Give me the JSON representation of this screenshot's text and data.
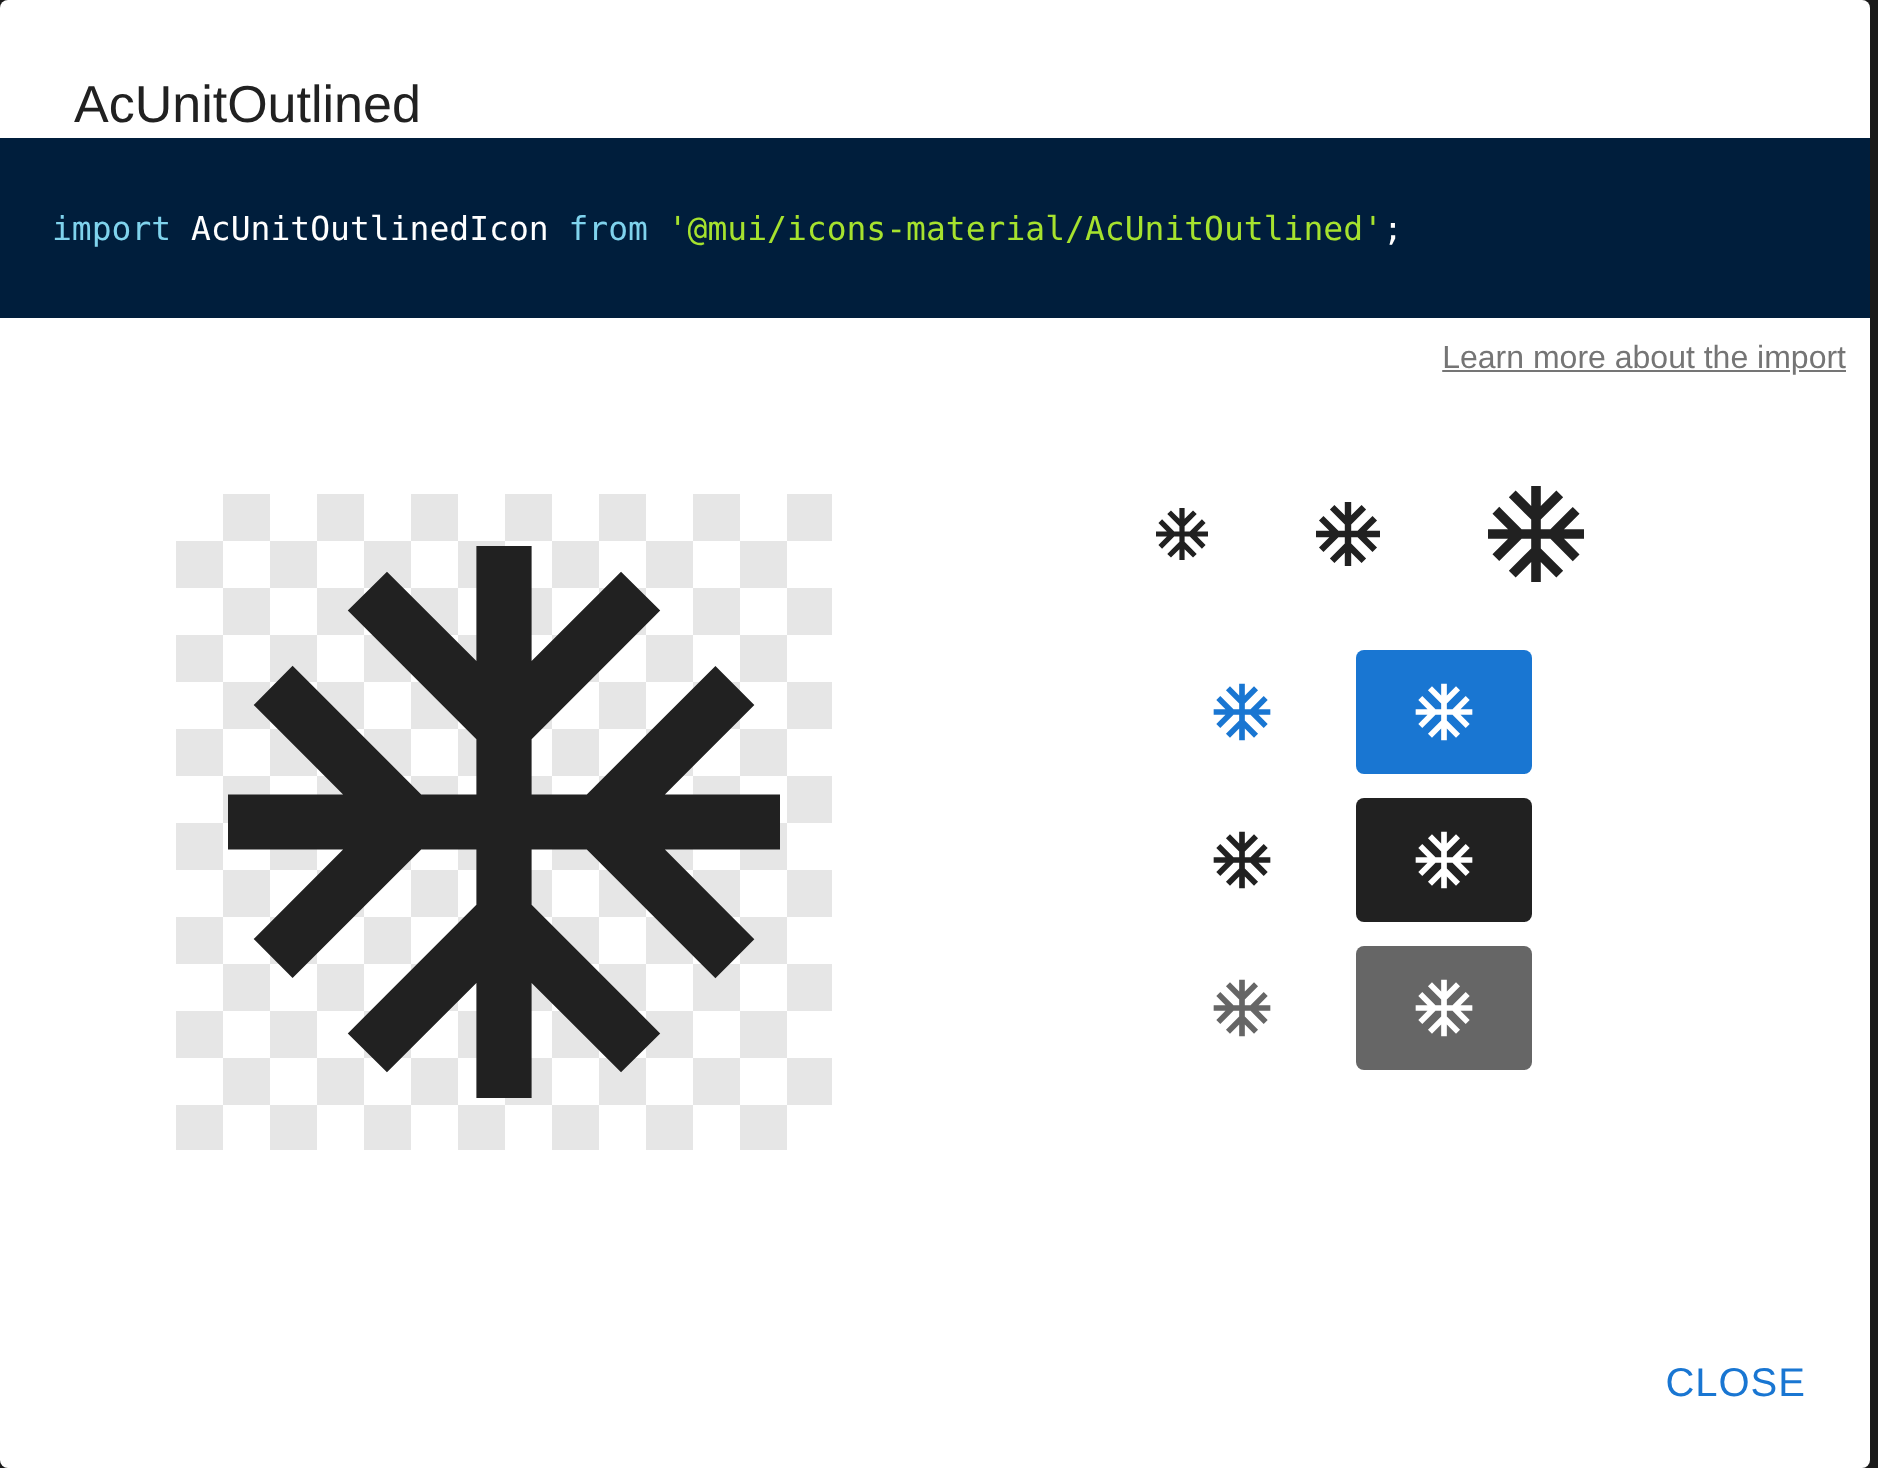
{
  "dialog": {
    "title": "AcUnitOutlined",
    "code": [
      {
        "kind": "keyword",
        "text": "import"
      },
      {
        "kind": "name",
        "text": "AcUnitOutlinedIcon"
      },
      {
        "kind": "keyword",
        "text": "from"
      },
      {
        "kind": "string",
        "text": "'@mui/icons-material/AcUnitOutlined'"
      },
      {
        "kind": "punct",
        "text": ";"
      }
    ],
    "link": "Learn more about the import",
    "color_variants": [
      {
        "color": "#1976d2"
      },
      {
        "color": "#212121"
      },
      {
        "color": "#666666"
      }
    ],
    "close_button": "CLOSE"
  }
}
